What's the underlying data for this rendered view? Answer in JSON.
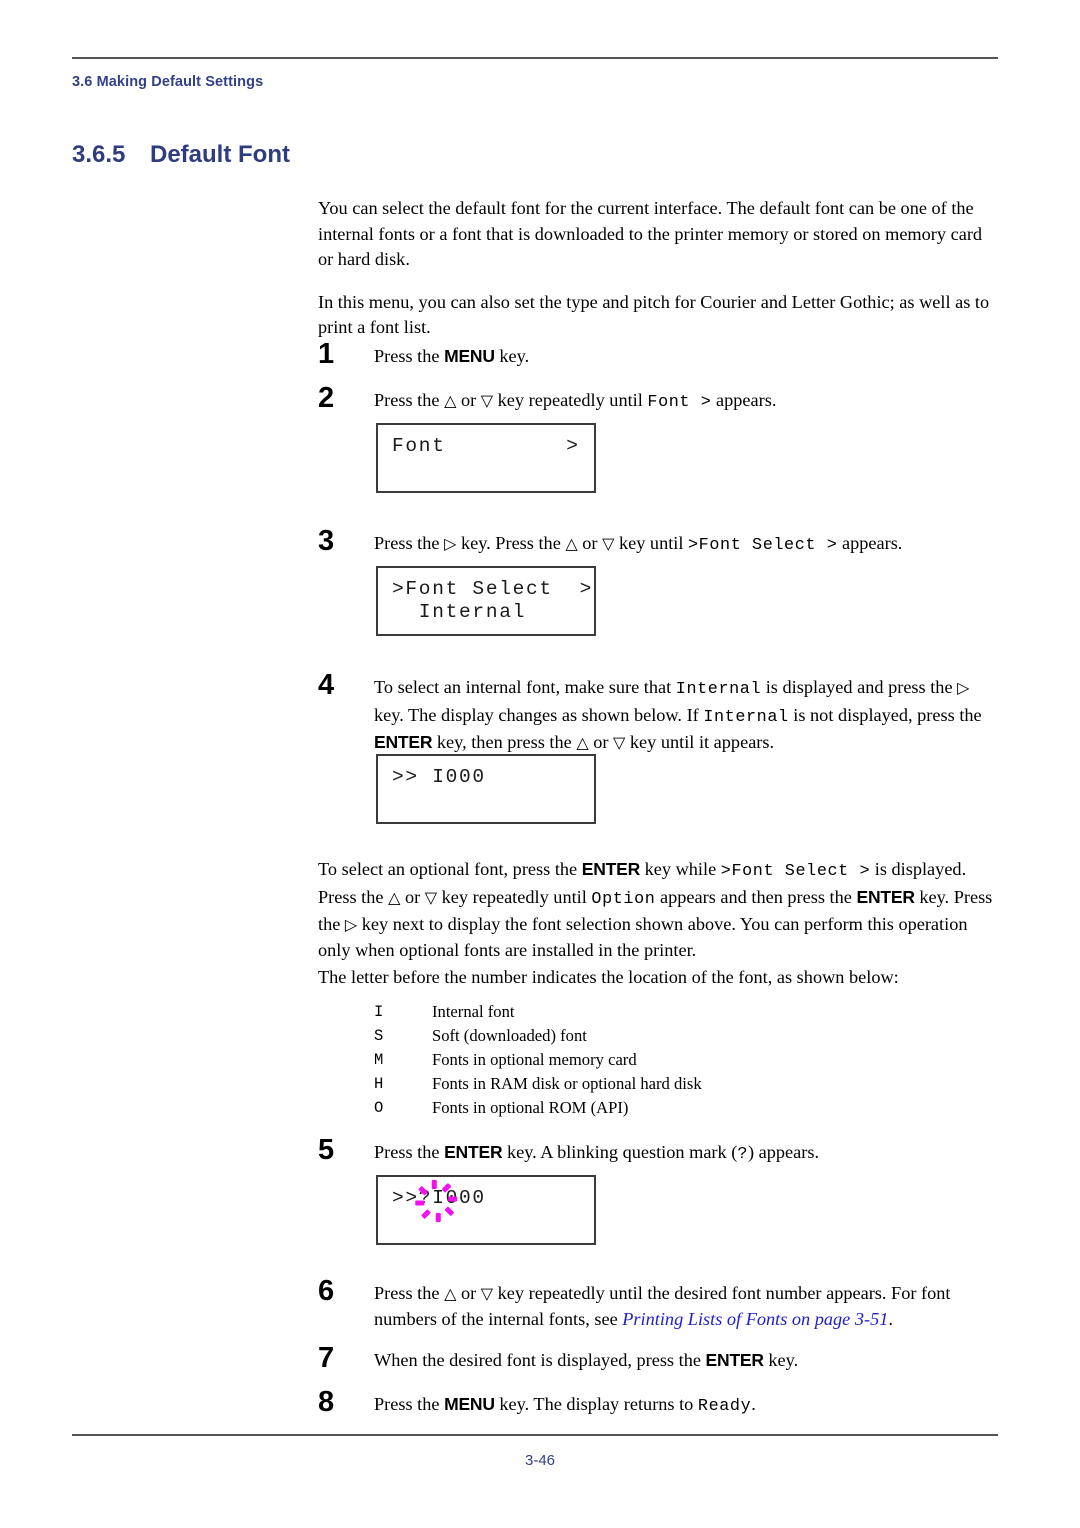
{
  "header": {
    "running_head": "3.6 Making Default Settings"
  },
  "heading": {
    "number": "3.6.5",
    "title": "Default Font"
  },
  "intro": {
    "para1": "You can select the default font for the current interface. The default font can be one of the internal fonts or a font that is downloaded to the printer memory or stored on memory card or hard disk.",
    "para2": "In this menu, you can also set the type and pitch for Courier and Letter Gothic; as well as to print a font list."
  },
  "steps": [
    {
      "index": "1",
      "parts": [
        {
          "t": "plain",
          "v": "Press the "
        },
        {
          "t": "key",
          "v": "MENU"
        },
        {
          "t": "plain",
          "v": " key."
        }
      ]
    },
    {
      "index": "2",
      "parts": [
        {
          "t": "plain",
          "v": "Press the "
        },
        {
          "t": "tri",
          "v": "△"
        },
        {
          "t": "plain",
          "v": " or "
        },
        {
          "t": "tri",
          "v": "▽"
        },
        {
          "t": "plain",
          "v": " key repeatedly until "
        },
        {
          "t": "mono",
          "v": "Font  >"
        },
        {
          "t": "plain",
          "v": " appears."
        }
      ]
    },
    {
      "index": "3",
      "parts": [
        {
          "t": "plain",
          "v": "Press the "
        },
        {
          "t": "tri",
          "v": "▷"
        },
        {
          "t": "plain",
          "v": " key. Press the "
        },
        {
          "t": "tri",
          "v": "△"
        },
        {
          "t": "plain",
          "v": " or "
        },
        {
          "t": "tri",
          "v": "▽"
        },
        {
          "t": "plain",
          "v": " key until "
        },
        {
          "t": "mono",
          "v": ">Font Select >"
        },
        {
          "t": "plain",
          "v": " appears."
        }
      ]
    },
    {
      "index": "4",
      "parts": [
        {
          "t": "plain",
          "v": "To select an internal font, make sure that "
        },
        {
          "t": "mono",
          "v": "Internal"
        },
        {
          "t": "plain",
          "v": " is displayed and press the "
        },
        {
          "t": "tri",
          "v": "▷"
        },
        {
          "t": "plain",
          "v": " key. The display changes as shown below. If "
        },
        {
          "t": "mono",
          "v": "Internal"
        },
        {
          "t": "plain",
          "v": " is not displayed, press the "
        },
        {
          "t": "key",
          "v": "ENTER"
        },
        {
          "t": "plain",
          "v": " key, then press the "
        },
        {
          "t": "tri",
          "v": "△"
        },
        {
          "t": "plain",
          "v": " or "
        },
        {
          "t": "tri",
          "v": "▽"
        },
        {
          "t": "plain",
          "v": " key until it appears."
        }
      ]
    },
    {
      "index": "5",
      "parts": [
        {
          "t": "plain",
          "v": "Press the "
        },
        {
          "t": "key",
          "v": "ENTER"
        },
        {
          "t": "plain",
          "v": " key. A blinking question mark ("
        },
        {
          "t": "mono",
          "v": "?"
        },
        {
          "t": "plain",
          "v": ") appears."
        }
      ]
    },
    {
      "index": "6",
      "parts": [
        {
          "t": "plain",
          "v": "Press the "
        },
        {
          "t": "tri",
          "v": "△"
        },
        {
          "t": "plain",
          "v": " or "
        },
        {
          "t": "tri",
          "v": "▽"
        },
        {
          "t": "plain",
          "v": " key repeatedly until the desired font number appears. For font numbers of the internal fonts, see "
        },
        {
          "t": "xref",
          "v": "Printing Lists of Fonts on page 3-51"
        },
        {
          "t": "plain",
          "v": "."
        }
      ]
    },
    {
      "index": "7",
      "parts": [
        {
          "t": "plain",
          "v": "When the desired font is displayed, press the "
        },
        {
          "t": "key",
          "v": "ENTER"
        },
        {
          "t": "plain",
          "v": " key."
        }
      ]
    },
    {
      "index": "8",
      "parts": [
        {
          "t": "plain",
          "v": "Press the "
        },
        {
          "t": "key",
          "v": "MENU"
        },
        {
          "t": "plain",
          "v": " key. The display returns to "
        },
        {
          "t": "mono",
          "v": "Ready"
        },
        {
          "t": "plain",
          "v": "."
        }
      ]
    }
  ],
  "lcd": {
    "font_menu": {
      "line1": "Font",
      "caret": ">",
      "line2": ""
    },
    "font_select": {
      "line1": ">Font Select  >",
      "line2": "  Internal"
    },
    "font_number": {
      "line1": ">> I000",
      "line2": ""
    },
    "font_blink": {
      "line1": ">>?I000",
      "line2": "",
      "blink_color": "#f50ff0"
    }
  },
  "optional_note": {
    "parts": [
      {
        "t": "plain",
        "v": "To select an optional font, press the "
      },
      {
        "t": "key",
        "v": "ENTER"
      },
      {
        "t": "plain",
        "v": " key while "
      },
      {
        "t": "mono",
        "v": ">Font Select >"
      },
      {
        "t": "plain",
        "v": " is displayed. Press the "
      },
      {
        "t": "tri",
        "v": "△"
      },
      {
        "t": "plain",
        "v": " or "
      },
      {
        "t": "tri",
        "v": "▽"
      },
      {
        "t": "plain",
        "v": " key repeatedly until "
      },
      {
        "t": "mono",
        "v": "Option"
      },
      {
        "t": "plain",
        "v": " appears and then press the "
      },
      {
        "t": "key",
        "v": "ENTER"
      },
      {
        "t": "plain",
        "v": " key. Press the "
      },
      {
        "t": "tri",
        "v": "▷"
      },
      {
        "t": "plain",
        "v": " key next to display the font selection shown above. You can perform this operation only when optional fonts are installed in the printer."
      }
    ]
  },
  "legend": {
    "intro": "The letter before the number indicates the location of the font, as shown below:",
    "rows": [
      {
        "code": "I",
        "desc": "Internal font"
      },
      {
        "code": "S",
        "desc": "Soft (downloaded) font"
      },
      {
        "code": "M",
        "desc": "Fonts in optional memory card"
      },
      {
        "code": "H",
        "desc": "Fonts in RAM disk or optional hard disk"
      },
      {
        "code": "O",
        "desc": "Fonts in optional ROM (API)"
      }
    ]
  },
  "footer": {
    "page_number": "3-46"
  },
  "colors": {
    "heading_blue": "#2e3d80",
    "running_head_blue": "#33418a",
    "xref_blue": "#2020cc",
    "blink_magenta": "#f50ff0",
    "rule_gray": "#555555"
  }
}
